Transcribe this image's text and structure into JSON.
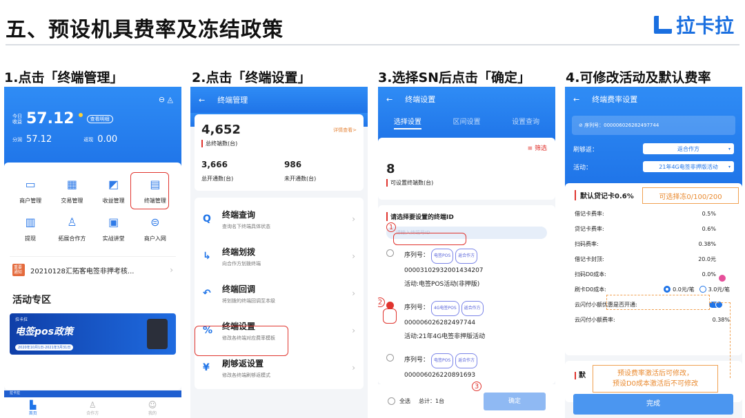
{
  "title": "五、预设机具费率及冻结政策",
  "logo": "拉卡拉",
  "steps": [
    "1.点击「终端管理」",
    "2.点击「终端设置」",
    "3.选择SN后点击「确定」",
    "4.可修改活动及默认费率"
  ],
  "p1": {
    "today_label": "今日收益",
    "amount": "57.12",
    "detail_btn": "查看明细",
    "split_label": "分润",
    "split_value": "57.12",
    "return_label": "返现",
    "return_value": "0.00",
    "grid": [
      "商户管理",
      "交易管理",
      "收益管理",
      "终端管理",
      "提现",
      "拓展合作方",
      "实战讲堂",
      "商户入网"
    ],
    "notice_badge": "重要通知",
    "notice_text": "20210128汇拓客电签非押考核...",
    "section": "活动专区",
    "banner_brand": "拉卡拉",
    "banner_title": "电签pos政策",
    "banner_date": "2020年10月1日-2021年3月31日",
    "banner2_brand": "拉卡拉",
    "tab_home": "首页",
    "tab_2": "合作方",
    "tab_3": "我的"
  },
  "p2": {
    "nav_title": "终端管理",
    "total": "4,652",
    "total_label": "总终端数(台)",
    "detail_link": "详情查看>",
    "opened": "3,666",
    "opened_label": "总开通数(台)",
    "unopened": "986",
    "unopened_label": "未开通数(台)",
    "menu": [
      {
        "title": "终端查询",
        "desc": "查询名下终端具体状态",
        "icon": "Q"
      },
      {
        "title": "终端划拨",
        "desc": "向合作方划拨终端",
        "icon": "↳"
      },
      {
        "title": "终端回调",
        "desc": "将划拨的终端回调至本级",
        "icon": "↶"
      },
      {
        "title": "终端设置",
        "desc": "修改各终端对应费率模板",
        "icon": "%"
      },
      {
        "title": "刷够返设置",
        "desc": "修改各终端刷够返模式",
        "icon": "¥"
      }
    ]
  },
  "p3": {
    "nav_title": "终端设置",
    "tabs": [
      "选择设置",
      "区间设置",
      "设置查询"
    ],
    "filter": "筛选",
    "count": "8",
    "count_label": "可设置终端数(台)",
    "prompt": "请选择要设置的终端ID",
    "search_placeholder": "请输入终端号ID",
    "sn_label": "序列号：",
    "items": [
      {
        "tag1": "电签POS",
        "tag2": "返合作方",
        "sn": "00003102932001434207",
        "activity": "活动:电签POS活动(非押版)"
      },
      {
        "tag1": "4G电签POS",
        "tag2": "返合作方",
        "sn": "000006026282497744",
        "activity": "活动:21年4G电签非押版活动"
      },
      {
        "tag1": "电签POS",
        "tag2": "返合作方",
        "sn": "000006026220891693",
        "activity": ""
      }
    ],
    "select_all": "全选",
    "total": "总计：1台",
    "confirm": "确定",
    "n1": "1",
    "n2": "2",
    "n3": "3"
  },
  "p4": {
    "nav_title": "终端费率设置",
    "sn": "序列号：000006026282497744",
    "return_label": "刷够返：",
    "return_value": "返合作方",
    "activity_label": "活动：",
    "activity_value": "21年4G电签非押版活动",
    "section_title": "默认贷记卡0.6%",
    "freeze_note": "可选择冻0/100/200",
    "rows": [
      {
        "label": "借记卡费率:",
        "value": "0.5%"
      },
      {
        "label": "贷记卡费率:",
        "value": "0.6%"
      },
      {
        "label": "扫码费率:",
        "value": "0.38%"
      },
      {
        "label": "借记卡封顶:",
        "value": "20.0元"
      },
      {
        "label": "扫码D0成本:",
        "value": "0.0%"
      }
    ],
    "d0_label": "刷卡D0成本:",
    "d0_opt1": "0.0元/笔",
    "d0_opt2": "3.0元/笔",
    "yun_label": "云闪付小额优惠是否开通:",
    "yun_rate_label": "云闪付小额费率:",
    "yun_rate_value": "0.38%",
    "section2": "默",
    "note_line1": "预设费率激活后可修改，",
    "note_line2": "预设D0成本激活后不可修改",
    "done": "完成"
  }
}
